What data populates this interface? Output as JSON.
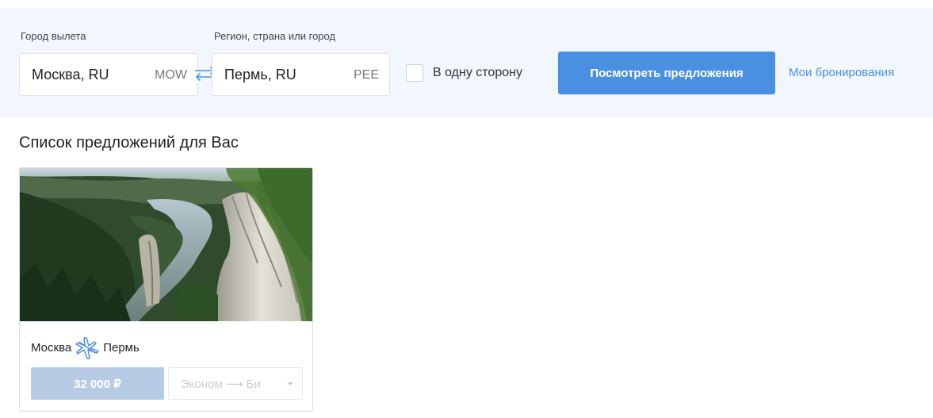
{
  "search": {
    "from_label": "Город вылета",
    "from_city": "Москва, RU",
    "from_code": "MOW",
    "to_label": "Регион, страна или город",
    "to_city": "Пермь, RU",
    "to_code": "PEE",
    "one_way_label": "В одну сторону",
    "one_way_checked": false,
    "submit_label": "Посмотреть предложения",
    "bookings_link": "Мои бронирования"
  },
  "offers": {
    "title": "Список предложений для Вас",
    "items": [
      {
        "from": "Москва",
        "to": "Пермь",
        "price": "32 000 ₽",
        "class_value": "Эконом ⟶ Би"
      }
    ]
  },
  "colors": {
    "accent": "#4a90e2",
    "panel_bg": "#f2f7fd",
    "price_bg": "#b7cce4"
  },
  "icons": [
    "swap-arrows-icon",
    "plane-icon",
    "chevron-down-icon"
  ]
}
